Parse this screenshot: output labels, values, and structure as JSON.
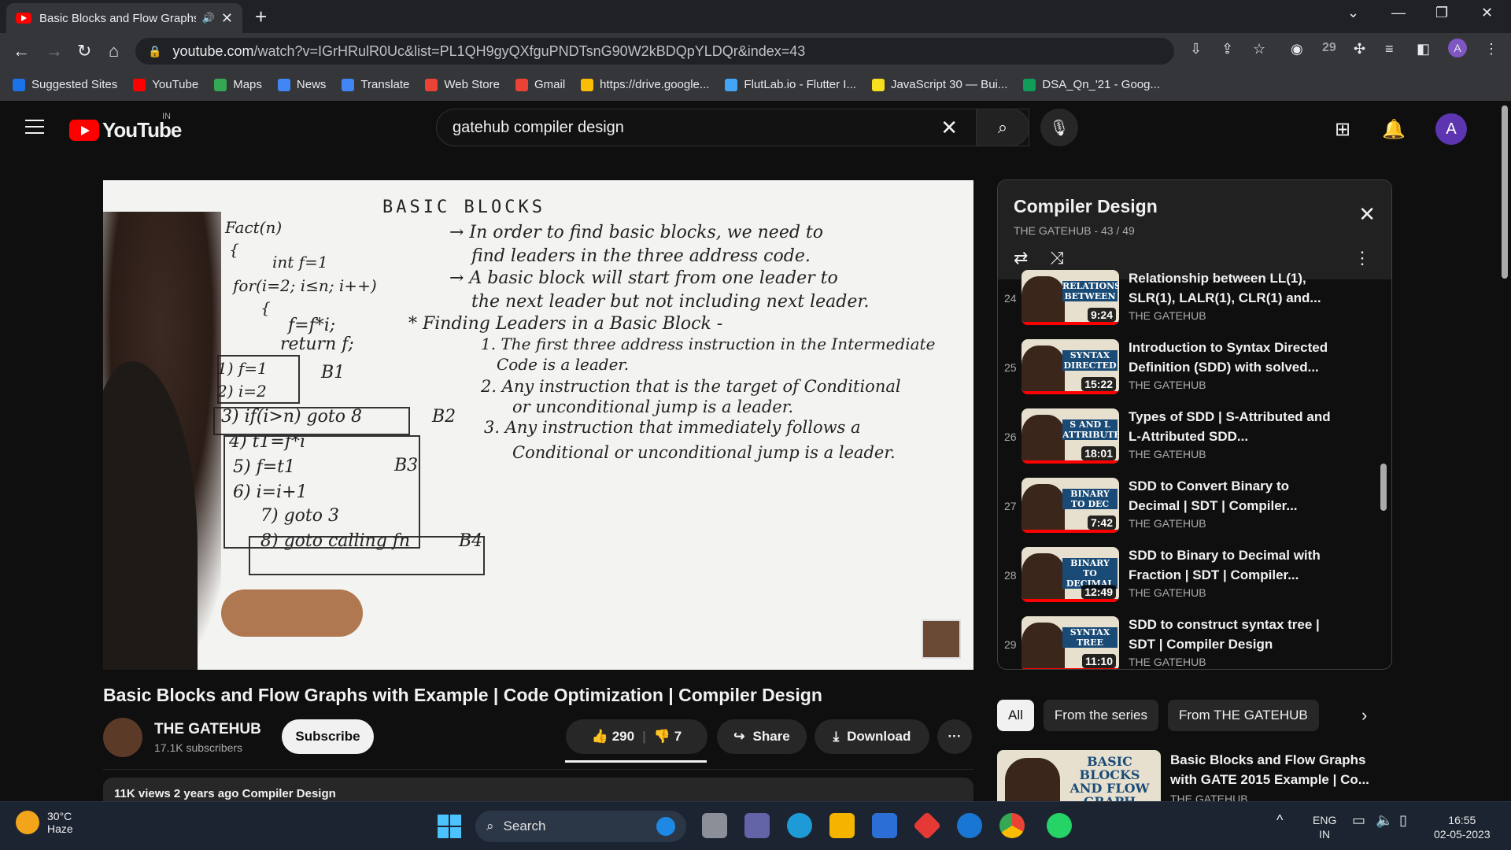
{
  "browser": {
    "tab_title": "Basic Blocks and Flow Graphs",
    "url_host": "youtube.com",
    "url_path": "/watch?v=IGrHRulR0Uc&list=PL1QH9gyQXfguPNDTsnG90W2kBDQpYLDQr&index=43",
    "ext_badge": "29",
    "profile_initial": "A"
  },
  "bookmarks": [
    {
      "label": "Suggested Sites",
      "color": "#1a73e8"
    },
    {
      "label": "YouTube",
      "color": "#ff0000"
    },
    {
      "label": "Maps",
      "color": "#34a853"
    },
    {
      "label": "News",
      "color": "#4285f4"
    },
    {
      "label": "Translate",
      "color": "#4285f4"
    },
    {
      "label": "Web Store",
      "color": "#ea4335"
    },
    {
      "label": "Gmail",
      "color": "#ea4335"
    },
    {
      "label": "https://drive.google...",
      "color": "#fbbc04"
    },
    {
      "label": "FlutLab.io - Flutter I...",
      "color": "#42a5f5"
    },
    {
      "label": "JavaScript 30 — Bui...",
      "color": "#f7df1e"
    },
    {
      "label": "DSA_Qn_'21 - Goog...",
      "color": "#0f9d58"
    }
  ],
  "masthead": {
    "logo_text": "YouTube",
    "country": "IN",
    "search_value": "gatehub compiler design",
    "avatar_initial": "A"
  },
  "board": {
    "title": "BASIC BLOCKS",
    "lines": [
      "Fact(n)",
      "{",
      "int f=1",
      "for(i=2; i≤n; i++)",
      "{",
      "f=f*i;",
      "return f;",
      "1) f=1",
      "2) i=2",
      "3) if(i>n) goto 8",
      "4) t1=f*i",
      "5) f=t1",
      "6) i=i+1",
      "7) goto 3",
      "8) goto calling fn",
      "B1",
      "B2",
      "B3",
      "B4",
      "→ In order to find basic blocks, we need to",
      "find leaders in the three address code.",
      "→ A basic block will start from one leader to",
      "the next leader but not including next leader.",
      "* Finding Leaders in a Basic Block -",
      "1. The first three address instruction in the Intermediate",
      "Code is a leader.",
      "2. Any instruction that is the target of Conditional",
      "or unconditional jump is a leader.",
      "3. Any instruction that immediately follows a",
      "Conditional or unconditional jump is a leader."
    ]
  },
  "video": {
    "title": "Basic Blocks and Flow Graphs with Example | Code Optimization | Compiler Design",
    "channel": "THE GATEHUB",
    "subscribers": "17.1K subscribers",
    "subscribe_label": "Subscribe",
    "likes": "290",
    "dislikes": "7",
    "share_label": "Share",
    "download_label": "Download",
    "more_label": "···",
    "desc_preview": "11K views  2 years ago  Compiler Design"
  },
  "playlist": {
    "title": "Compiler Design",
    "subtitle": "THE GATEHUB - 43 / 49",
    "items": [
      {
        "index": "24",
        "title": "Relationship between LL(1), SLR(1), LALR(1), CLR(1) and...",
        "channel": "THE GATEHUB",
        "duration": "9:24",
        "thumb_label": "RELATIONSHIP BETWEEN"
      },
      {
        "index": "25",
        "title": "Introduction to Syntax Directed Definition (SDD) with solved...",
        "channel": "THE GATEHUB",
        "duration": "15:22",
        "thumb_label": "SYNTAX DIRECTED"
      },
      {
        "index": "26",
        "title": "Types of SDD | S-Attributed and L-Attributed SDD...",
        "channel": "THE GATEHUB",
        "duration": "18:01",
        "thumb_label": "S AND L ATTRIBUTED"
      },
      {
        "index": "27",
        "title": "SDD to Convert Binary to Decimal | SDT | Compiler...",
        "channel": "THE GATEHUB",
        "duration": "7:42",
        "thumb_label": "BINARY TO DEC"
      },
      {
        "index": "28",
        "title": "SDD to Binary to Decimal with Fraction | SDT | Compiler...",
        "channel": "THE GATEHUB",
        "duration": "12:49",
        "thumb_label": "BINARY TO DECIMAL"
      },
      {
        "index": "29",
        "title": "SDD to construct syntax tree | SDT | Compiler Design",
        "channel": "THE GATEHUB",
        "duration": "11:10",
        "thumb_label": "SYNTAX TREE"
      }
    ]
  },
  "chips": {
    "all": "All",
    "series": "From the series",
    "channel": "From THE GATEHUB"
  },
  "recommendation": {
    "title": "Basic Blocks and Flow Graphs with GATE 2015 Example | Co...",
    "thumb_label": "BASIC BLOCKS AND FLOW GRAPH",
    "channel": "THE GATEHUB"
  },
  "taskbar": {
    "temp": "30°C",
    "weather": "Haze",
    "search_label": "Search",
    "lang": "ENG",
    "region": "IN",
    "time": "16:55",
    "date": "02-05-2023"
  }
}
